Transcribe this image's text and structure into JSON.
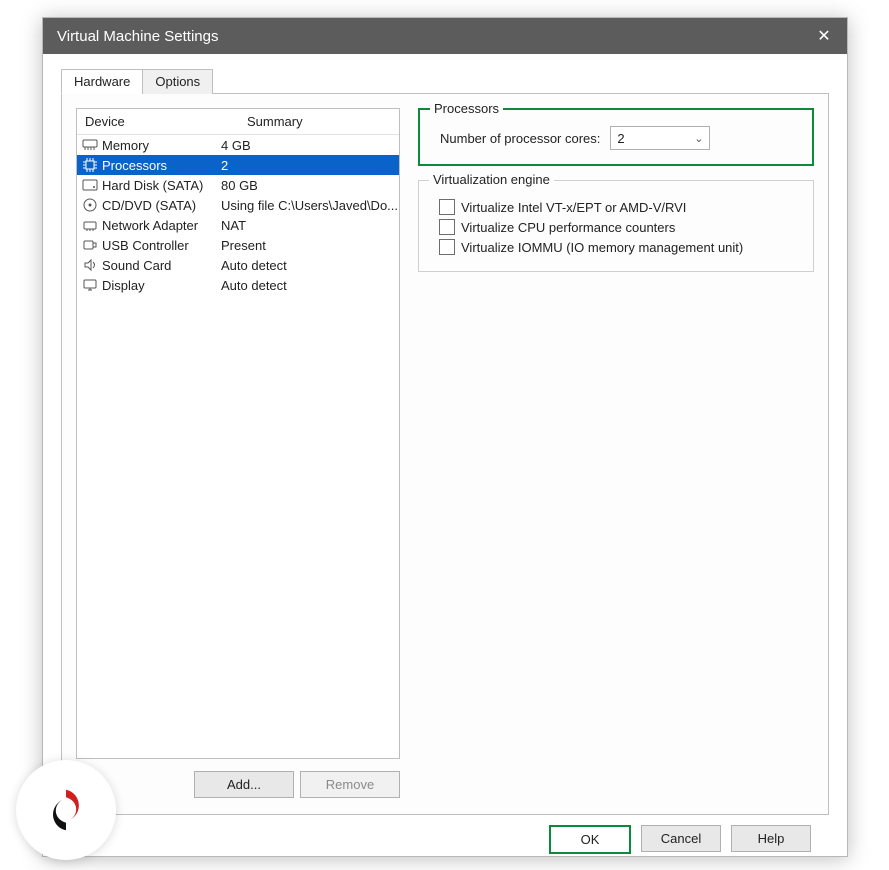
{
  "title": "Virtual Machine Settings",
  "tabs": {
    "hardware": "Hardware",
    "options": "Options"
  },
  "device_list": {
    "headers": {
      "device": "Device",
      "summary": "Summary"
    },
    "rows": [
      {
        "name": "Memory",
        "summary": "4 GB",
        "icon": "memory-icon",
        "selected": false
      },
      {
        "name": "Processors",
        "summary": "2",
        "icon": "cpu-icon",
        "selected": true
      },
      {
        "name": "Hard Disk (SATA)",
        "summary": "80 GB",
        "icon": "disk-icon",
        "selected": false
      },
      {
        "name": "CD/DVD (SATA)",
        "summary": "Using file C:\\Users\\Javed\\Do...",
        "icon": "disc-icon",
        "selected": false
      },
      {
        "name": "Network Adapter",
        "summary": "NAT",
        "icon": "network-icon",
        "selected": false
      },
      {
        "name": "USB Controller",
        "summary": "Present",
        "icon": "usb-icon",
        "selected": false
      },
      {
        "name": "Sound Card",
        "summary": "Auto detect",
        "icon": "sound-icon",
        "selected": false
      },
      {
        "name": "Display",
        "summary": "Auto detect",
        "icon": "display-icon",
        "selected": false
      }
    ],
    "add_label": "Add...",
    "remove_label": "Remove"
  },
  "processors": {
    "legend": "Processors",
    "cores_label": "Number of processor cores:",
    "cores_value": "2"
  },
  "virt_engine": {
    "legend": "Virtualization engine",
    "opt1": "Virtualize Intel VT-x/EPT or AMD-V/RVI",
    "opt2": "Virtualize CPU performance counters",
    "opt3": "Virtualize IOMMU (IO memory management unit)"
  },
  "buttons": {
    "ok": "OK",
    "cancel": "Cancel",
    "help": "Help"
  }
}
